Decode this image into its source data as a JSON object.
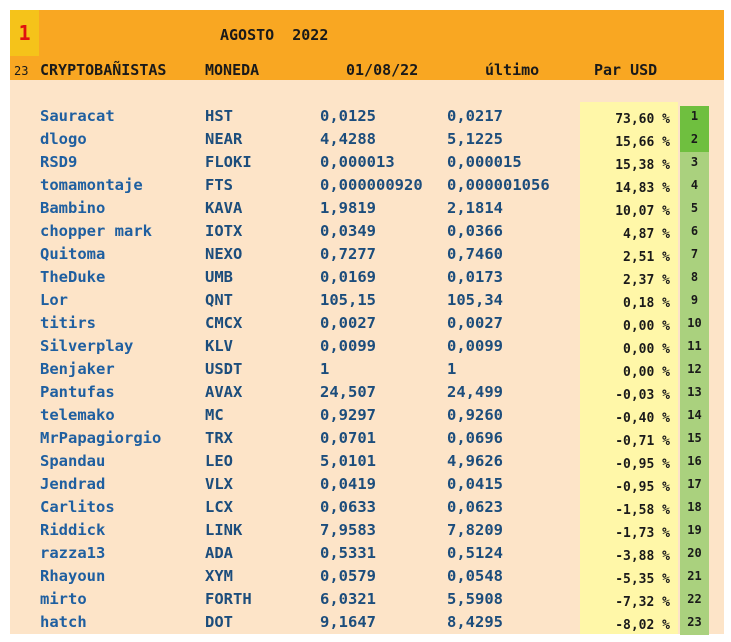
{
  "header": {
    "rank_number": "1",
    "month": "AGOSTO",
    "year": "2022",
    "participant_count": "23",
    "col_name": "CRYPTOBAÑISTAS",
    "col_coin": "MONEDA",
    "col_start": "01/08/22",
    "col_last": "último",
    "col_pair": "Par USD"
  },
  "colors": {
    "header_bg": "#f9a722",
    "sheet_bg": "#fde4c8",
    "pct_bg": "#fff7a8",
    "rank_top_bg": "#6fbf3f",
    "rank_bg": "#aad17e",
    "rank_number_color": "#e01010"
  },
  "rows": [
    {
      "name": "Sauracat",
      "coin": "HST",
      "start": "0,0125",
      "last": "0,0217",
      "pct": "73,60 %",
      "rank": "1"
    },
    {
      "name": "dlogo",
      "coin": "NEAR",
      "start": "4,4288",
      "last": "5,1225",
      "pct": "15,66 %",
      "rank": "2"
    },
    {
      "name": "RSD9",
      "coin": "FLOKI",
      "start": "0,000013",
      "last": "0,000015",
      "pct": "15,38 %",
      "rank": "3"
    },
    {
      "name": "tomamontaje",
      "coin": "FTS",
      "start": "0,000000920",
      "last": "0,000001056",
      "pct": "14,83 %",
      "rank": "4"
    },
    {
      "name": "Bambino",
      "coin": "KAVA",
      "start": "1,9819",
      "last": "2,1814",
      "pct": "10,07 %",
      "rank": "5"
    },
    {
      "name": "chopper mark",
      "coin": "IOTX",
      "start": "0,0349",
      "last": "0,0366",
      "pct": "4,87 %",
      "rank": "6"
    },
    {
      "name": "Quitoma",
      "coin": "NEXO",
      "start": "0,7277",
      "last": "0,7460",
      "pct": "2,51 %",
      "rank": "7"
    },
    {
      "name": "TheDuke",
      "coin": "UMB",
      "start": "0,0169",
      "last": "0,0173",
      "pct": "2,37 %",
      "rank": "8"
    },
    {
      "name": "Lor",
      "coin": "QNT",
      "start": "105,15",
      "last": "105,34",
      "pct": "0,18 %",
      "rank": "9"
    },
    {
      "name": "titirs",
      "coin": "CMCX",
      "start": "0,0027",
      "last": "0,0027",
      "pct": "0,00 %",
      "rank": "10"
    },
    {
      "name": "Silverplay",
      "coin": "KLV",
      "start": "0,0099",
      "last": "0,0099",
      "pct": "0,00 %",
      "rank": "11"
    },
    {
      "name": "Benjaker",
      "coin": "USDT",
      "start": "1",
      "last": "1",
      "pct": "0,00 %",
      "rank": "12"
    },
    {
      "name": "Pantufas",
      "coin": "AVAX",
      "start": "24,507",
      "last": "24,499",
      "pct": "-0,03 %",
      "rank": "13"
    },
    {
      "name": "telemako",
      "coin": "MC",
      "start": "0,9297",
      "last": "0,9260",
      "pct": "-0,40 %",
      "rank": "14"
    },
    {
      "name": "MrPapagiorgio",
      "coin": "TRX",
      "start": "0,0701",
      "last": "0,0696",
      "pct": "-0,71 %",
      "rank": "15"
    },
    {
      "name": "Spandau",
      "coin": "LEO",
      "start": "5,0101",
      "last": "4,9626",
      "pct": "-0,95 %",
      "rank": "16"
    },
    {
      "name": "Jendrad",
      "coin": "VLX",
      "start": "0,0419",
      "last": "0,0415",
      "pct": "-0,95 %",
      "rank": "17"
    },
    {
      "name": "Carlitos",
      "coin": "LCX",
      "start": "0,0633",
      "last": "0,0623",
      "pct": "-1,58 %",
      "rank": "18"
    },
    {
      "name": "Riddick",
      "coin": "LINK",
      "start": "7,9583",
      "last": "7,8209",
      "pct": "-1,73 %",
      "rank": "19"
    },
    {
      "name": "razza13",
      "coin": "ADA",
      "start": "0,5331",
      "last": "0,5124",
      "pct": "-3,88 %",
      "rank": "20"
    },
    {
      "name": "Rhayoun",
      "coin": "XYM",
      "start": "0,0579",
      "last": "0,0548",
      "pct": "-5,35 %",
      "rank": "21"
    },
    {
      "name": "mirto",
      "coin": "FORTH",
      "start": "6,0321",
      "last": "5,5908",
      "pct": "-7,32 %",
      "rank": "22"
    },
    {
      "name": "hatch",
      "coin": "DOT",
      "start": "9,1647",
      "last": "8,4295",
      "pct": "-8,02 %",
      "rank": "23"
    }
  ]
}
